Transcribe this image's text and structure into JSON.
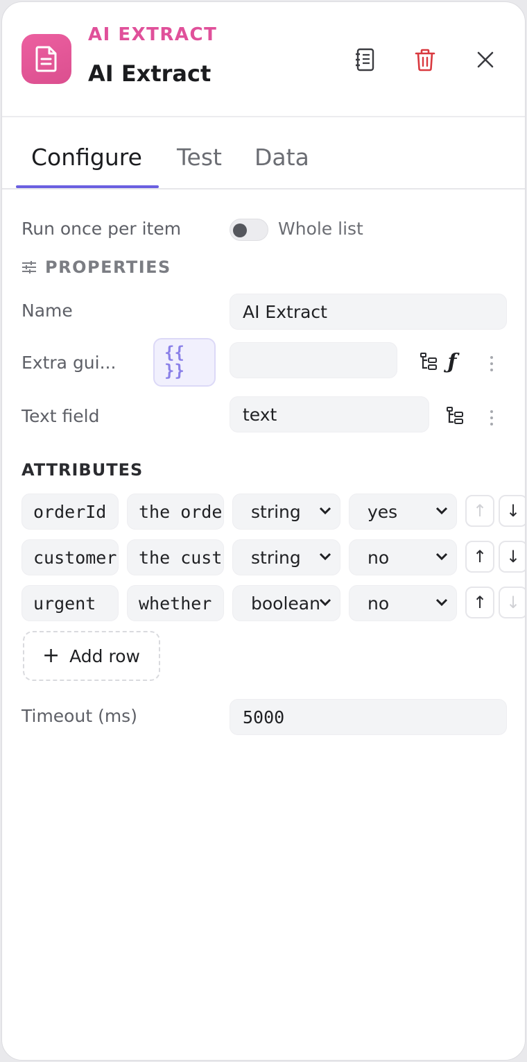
{
  "header": {
    "kind": "AI EXTRACT",
    "title": "AI Extract",
    "icons": {
      "node": "document-icon",
      "docs": "notebook-icon",
      "delete": "trash-icon",
      "close": "close-icon"
    },
    "colors": {
      "accent": "#e0509a",
      "delete": "#d9393f"
    }
  },
  "tabs": [
    {
      "label": "Configure",
      "active": true
    },
    {
      "label": "Test",
      "active": false
    },
    {
      "label": "Data",
      "active": false
    }
  ],
  "run_mode": {
    "label": "Run once per item",
    "toggle_label": "Whole list",
    "enabled": false
  },
  "properties": {
    "heading": "PROPERTIES",
    "name": {
      "label": "Name",
      "value": "AI Extract"
    },
    "extra_guidance": {
      "label": "Extra gui...",
      "value": "",
      "template_button": "{{ }}",
      "fx_label": "ƒ"
    },
    "text_field": {
      "label": "Text field",
      "value": "text"
    }
  },
  "attributes": {
    "heading": "ATTRIBUTES",
    "rows": [
      {
        "name": "orderId",
        "description": "the order",
        "type": "string",
        "required": "yes",
        "up_enabled": false,
        "down_enabled": true
      },
      {
        "name": "customer",
        "description": "the customer",
        "type": "string",
        "required": "no",
        "up_enabled": true,
        "down_enabled": true
      },
      {
        "name": "urgent",
        "description": "whether",
        "type": "boolean",
        "required": "no",
        "up_enabled": true,
        "down_enabled": false
      }
    ],
    "add_row_label": "Add row",
    "arrow_up": "↑",
    "arrow_down": "↓"
  },
  "timeout": {
    "label": "Timeout (ms)",
    "value": "5000"
  }
}
